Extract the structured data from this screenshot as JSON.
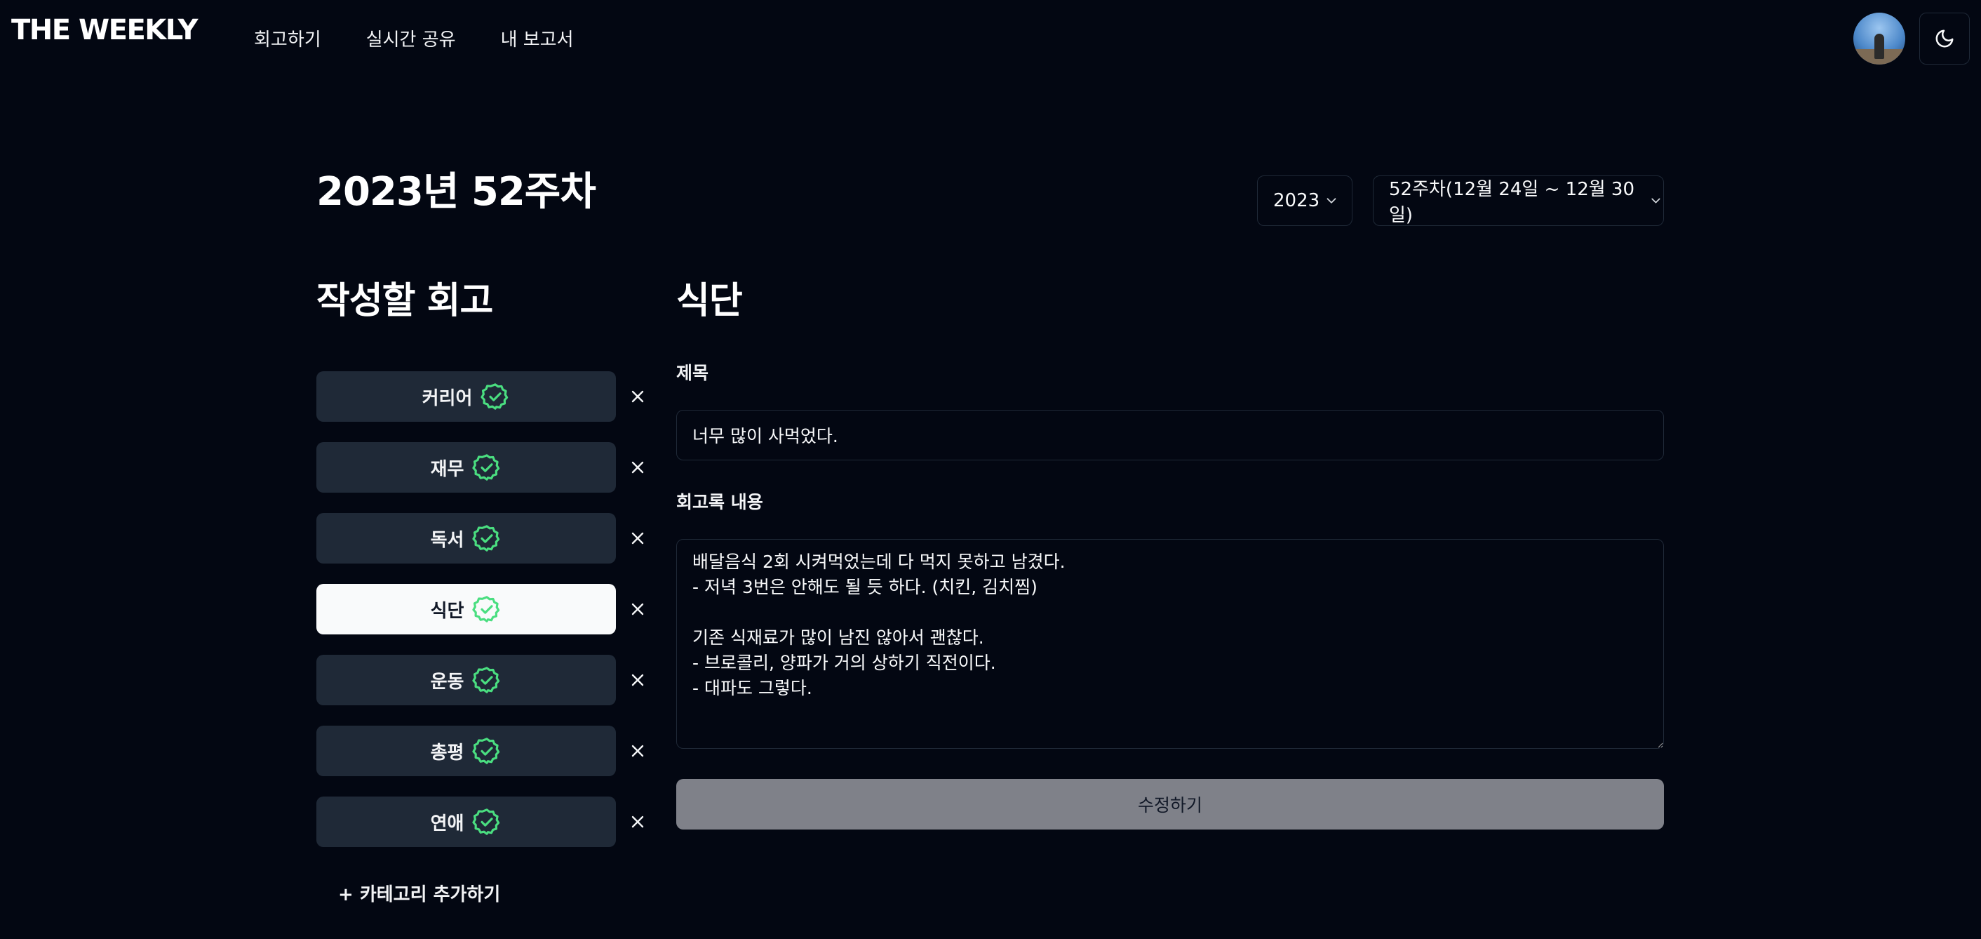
{
  "header": {
    "logo": "THE WEEKLY",
    "nav": [
      "회고하기",
      "실시간 공유",
      "내 보고서"
    ],
    "theme_icon": "moon-icon"
  },
  "page": {
    "title": "2023년 52주차",
    "year_select": "2023",
    "week_select": "52주차(12월 24일 ~ 12월 30일)"
  },
  "categories": {
    "heading": "작성할 회고",
    "items": [
      {
        "label": "커리어",
        "done": true,
        "active": false
      },
      {
        "label": "재무",
        "done": true,
        "active": false
      },
      {
        "label": "독서",
        "done": true,
        "active": false
      },
      {
        "label": "식단",
        "done": true,
        "active": true
      },
      {
        "label": "운동",
        "done": true,
        "active": false
      },
      {
        "label": "총평",
        "done": true,
        "active": false
      },
      {
        "label": "연애",
        "done": true,
        "active": false
      }
    ],
    "add_label": "+ 카테고리 추가하기",
    "check_color": "#4ade80"
  },
  "form": {
    "heading": "식단",
    "title_label": "제목",
    "title_value": "너무 많이 사먹었다.",
    "content_label": "회고록 내용",
    "content_value": "배달음식 2회 시켜먹었는데 다 먹지 못하고 남겼다.\n- 저녁 3번은 안해도 될 듯 하다. (치킨, 김치찜)\n\n기존 식재료가 많이 남진 않아서 괜찮다.\n- 브로콜리, 양파가 거의 상하기 직전이다.\n- 대파도 그렇다.",
    "submit_label": "수정하기"
  }
}
